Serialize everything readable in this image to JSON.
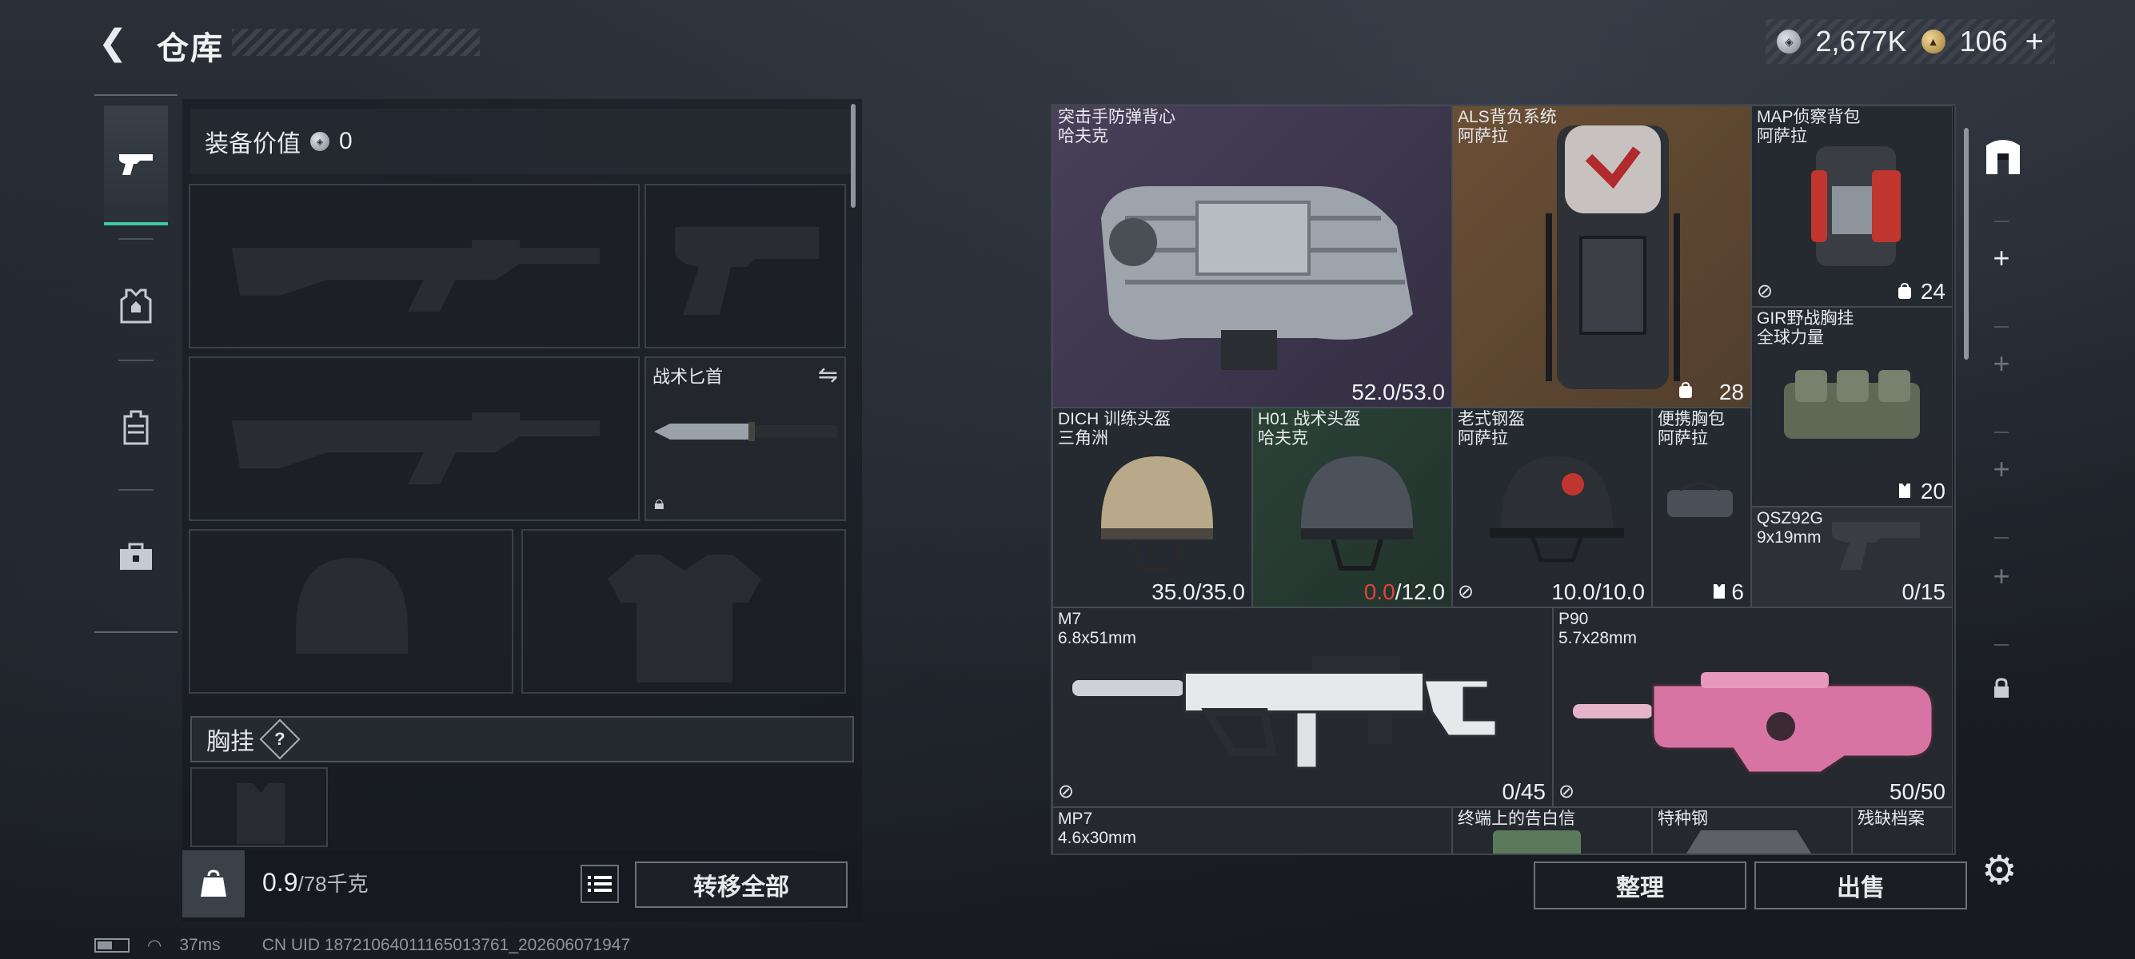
{
  "header": {
    "back_icon": "back-arrow-icon",
    "title": "仓库",
    "currency_silver": "2,677K",
    "currency_gold": "106",
    "add_label": "+"
  },
  "nav": {
    "items": [
      {
        "name": "weapons",
        "icon": "pistol-icon",
        "active": true
      },
      {
        "name": "armor",
        "icon": "vest-icon",
        "active": false
      },
      {
        "name": "backpack",
        "icon": "backpack-icon",
        "active": false
      },
      {
        "name": "tools",
        "icon": "toolbox-icon",
        "active": false
      }
    ]
  },
  "loadout": {
    "value_label": "装备价值",
    "value": "0",
    "knife_label": "战术匕首",
    "chest_rig_label": "胸挂",
    "help_label": "?",
    "weight_current": "0.9",
    "weight_max": "/78千克",
    "transfer_label": "转移全部"
  },
  "stash": {
    "items": [
      {
        "id": "vest",
        "name": "突击手防弹背心",
        "sub": "哈夫克",
        "value": "52.0/53.0"
      },
      {
        "id": "als",
        "name": "ALS背负系统",
        "sub": "阿萨拉",
        "value": "28"
      },
      {
        "id": "map",
        "name": "MAP侦察背包",
        "sub": "阿萨拉",
        "value": "24"
      },
      {
        "id": "gir",
        "name": "GIR野战胸挂",
        "sub": "全球力量",
        "value": "20"
      },
      {
        "id": "dich",
        "name": "DICH 训练头盔",
        "sub": "三角洲",
        "value": "35.0/35.0"
      },
      {
        "id": "h01",
        "name": "H01 战术头盔",
        "sub": "哈夫克",
        "value_red": "0.0",
        "value_rest": "/12.0"
      },
      {
        "id": "oldhelm",
        "name": "老式钢盔",
        "sub": "阿萨拉",
        "value": "10.0/10.0"
      },
      {
        "id": "chestbag",
        "name": "便携胸包",
        "sub": "阿萨拉",
        "value": "6"
      },
      {
        "id": "qsz",
        "name": "QSZ92G",
        "sub": "9x19mm",
        "value": "0/15"
      },
      {
        "id": "m7",
        "name": "M7",
        "sub": "6.8x51mm",
        "value": "0/45"
      },
      {
        "id": "p90",
        "name": "P90",
        "sub": "5.7x28mm",
        "value": "50/50"
      },
      {
        "id": "mp7",
        "name": "MP7",
        "sub": "4.6x30mm"
      },
      {
        "id": "terminal",
        "name": "终端上的告白信"
      },
      {
        "id": "special",
        "name": "特种钢"
      },
      {
        "id": "archive",
        "name": "残缺档案"
      }
    ],
    "sort_label": "整理",
    "sell_label": "出售"
  },
  "rail": {
    "icons": [
      "stash-box-icon",
      "plus-icon",
      "plus-icon",
      "plus-icon",
      "plus-icon",
      "lock-icon"
    ]
  },
  "statusbar": {
    "ping": "37ms",
    "uid": "CN UID 18721064011165013761_202606071947"
  }
}
